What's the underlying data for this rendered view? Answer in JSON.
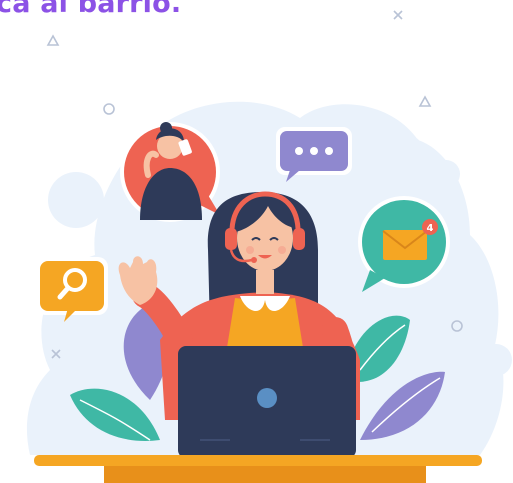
{
  "header": {
    "headline_text": "ca al barrio.",
    "headline_color": "#8c52e6"
  },
  "illustration": {
    "subject": "customer-support-agent",
    "icons": [
      "headset-icon",
      "chat-bubble-icon",
      "mail-icon",
      "search-icon",
      "phone-call-avatar-icon",
      "laptop-icon"
    ],
    "notification_badge": "4",
    "colors": {
      "background_blob": "#eaf2fb",
      "accent_orange": "#f5a623",
      "accent_red": "#ee6352",
      "accent_teal": "#3fb8a5",
      "accent_purple": "#8f88cf",
      "navy": "#2e3a59"
    }
  }
}
